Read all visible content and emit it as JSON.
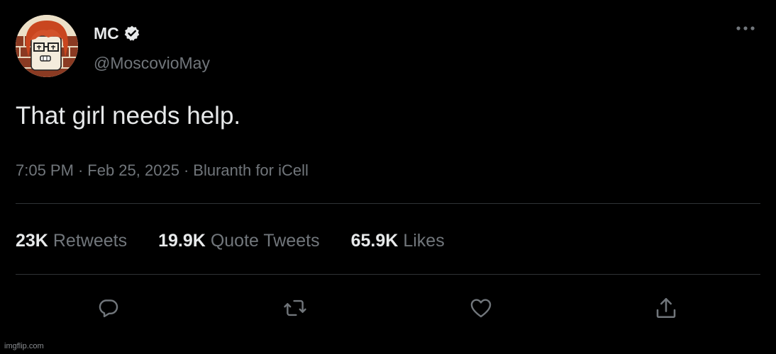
{
  "user": {
    "display_name": "MC",
    "handle": "@MoscovioMay",
    "verified": true
  },
  "tweet": {
    "text": "That girl needs help."
  },
  "meta": {
    "time": "7:05 PM",
    "separator1": "·",
    "date": "Feb 25, 2025",
    "separator2": "·",
    "client": "Bluranth for iCell"
  },
  "stats": {
    "retweets_count": "23K",
    "retweets_label": "Retweets",
    "quotes_count": "19.9K",
    "quotes_label": "Quote Tweets",
    "likes_count": "65.9K",
    "likes_label": "Likes"
  },
  "actions": {
    "reply_icon": "reply-icon",
    "retweet_icon": "retweet-icon",
    "like_icon": "heart-icon",
    "share_icon": "share-icon"
  },
  "watermark": "imgflip.com",
  "colors": {
    "background": "#000000",
    "primary_text": "#e7e9ea",
    "secondary_text": "#71767b",
    "divider": "#2f3336"
  }
}
